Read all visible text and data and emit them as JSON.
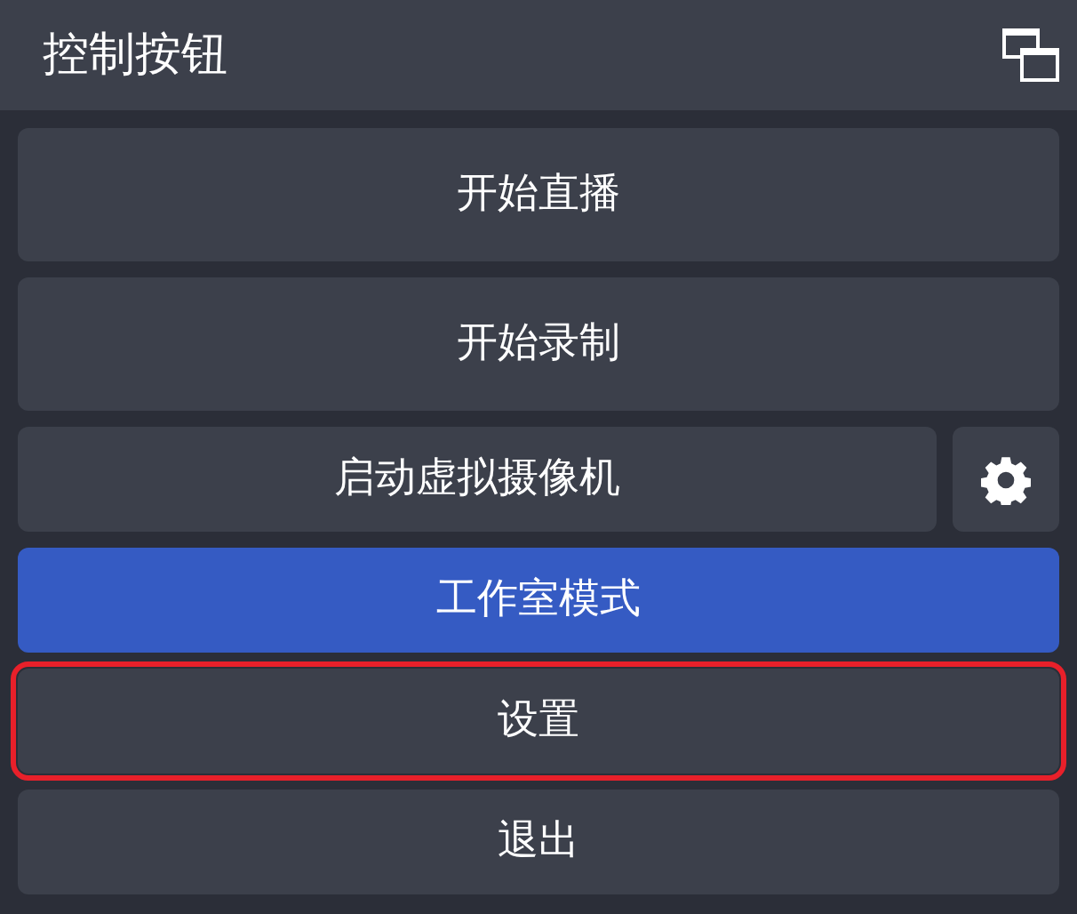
{
  "dock": {
    "title": "控制按钮"
  },
  "buttons": [
    {
      "kind": "tall",
      "label": "开始直播",
      "checked": false,
      "highlighted": false
    },
    {
      "kind": "tall",
      "label": "开始录制",
      "checked": false,
      "highlighted": false
    },
    {
      "kind": "with-settings",
      "label": "启动虚拟摄像机",
      "checked": false,
      "highlighted": false
    },
    {
      "kind": "short",
      "label": "工作室模式",
      "checked": true,
      "highlighted": false
    },
    {
      "kind": "short",
      "label": "设置",
      "checked": false,
      "highlighted": true
    },
    {
      "kind": "short",
      "label": "退出",
      "checked": false,
      "highlighted": false
    }
  ]
}
